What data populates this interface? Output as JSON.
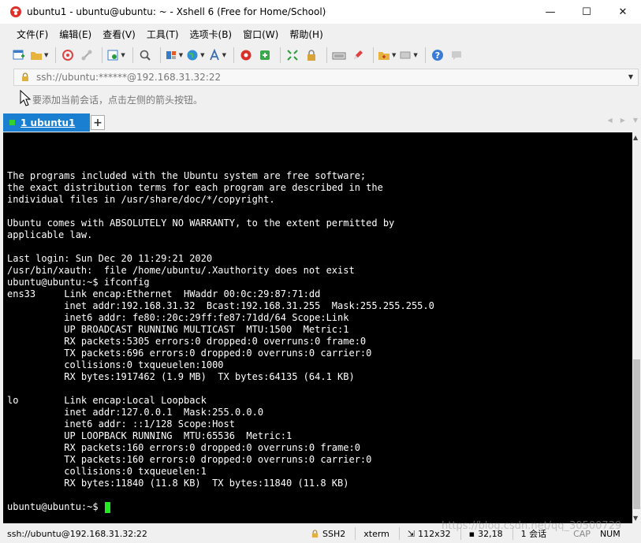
{
  "window": {
    "title": "ubuntu1 - ubuntu@ubuntu: ~ - Xshell 6 (Free for Home/School)",
    "minimize": "—",
    "maximize": "☐",
    "close": "✕"
  },
  "menu": [
    "文件(F)",
    "编辑(E)",
    "查看(V)",
    "工具(T)",
    "选项卡(B)",
    "窗口(W)",
    "帮助(H)"
  ],
  "address": {
    "text": "ssh://ubuntu:******@192.168.31.32:22"
  },
  "hint": {
    "text": "要添加当前会话，点击左侧的箭头按钮。"
  },
  "tabs": [
    {
      "label": "1 ubuntu1",
      "active": true
    }
  ],
  "tab_add": "+",
  "terminal": {
    "lines": [
      "The programs included with the Ubuntu system are free software;",
      "the exact distribution terms for each program are described in the",
      "individual files in /usr/share/doc/*/copyright.",
      "",
      "Ubuntu comes with ABSOLUTELY NO WARRANTY, to the extent permitted by",
      "applicable law.",
      "",
      "Last login: Sun Dec 20 11:29:21 2020",
      "/usr/bin/xauth:  file /home/ubuntu/.Xauthority does not exist",
      "ubuntu@ubuntu:~$ ifconfig",
      "ens33     Link encap:Ethernet  HWaddr 00:0c:29:87:71:dd",
      "          inet addr:192.168.31.32  Bcast:192.168.31.255  Mask:255.255.255.0",
      "          inet6 addr: fe80::20c:29ff:fe87:71dd/64 Scope:Link",
      "          UP BROADCAST RUNNING MULTICAST  MTU:1500  Metric:1",
      "          RX packets:5305 errors:0 dropped:0 overruns:0 frame:0",
      "          TX packets:696 errors:0 dropped:0 overruns:0 carrier:0",
      "          collisions:0 txqueuelen:1000",
      "          RX bytes:1917462 (1.9 MB)  TX bytes:64135 (64.1 KB)",
      "",
      "lo        Link encap:Local Loopback",
      "          inet addr:127.0.0.1  Mask:255.0.0.0",
      "          inet6 addr: ::1/128 Scope:Host",
      "          UP LOOPBACK RUNNING  MTU:65536  Metric:1",
      "          RX packets:160 errors:0 dropped:0 overruns:0 frame:0",
      "          TX packets:160 errors:0 dropped:0 overruns:0 carrier:0",
      "          collisions:0 txqueuelen:1",
      "          RX bytes:11840 (11.8 KB)  TX bytes:11840 (11.8 KB)"
    ],
    "prompt": "ubuntu@ubuntu:~$ "
  },
  "status": {
    "connection": "ssh://ubuntu@192.168.31.32:22",
    "protocol": "SSH2",
    "terminal_type": "xterm",
    "size": "112x32",
    "cursor_pos": "32,18",
    "sessions": "1 会话",
    "caps": "CAP",
    "num": "NUM"
  },
  "watermark": "https://blog.csdn.net/qq_30500729",
  "colors": {
    "tab_active": "#1a7fd1",
    "terminal_bg": "#000000",
    "terminal_fg": "#ffffff",
    "cursor": "#22e822",
    "status_ok": "#34d22e"
  }
}
